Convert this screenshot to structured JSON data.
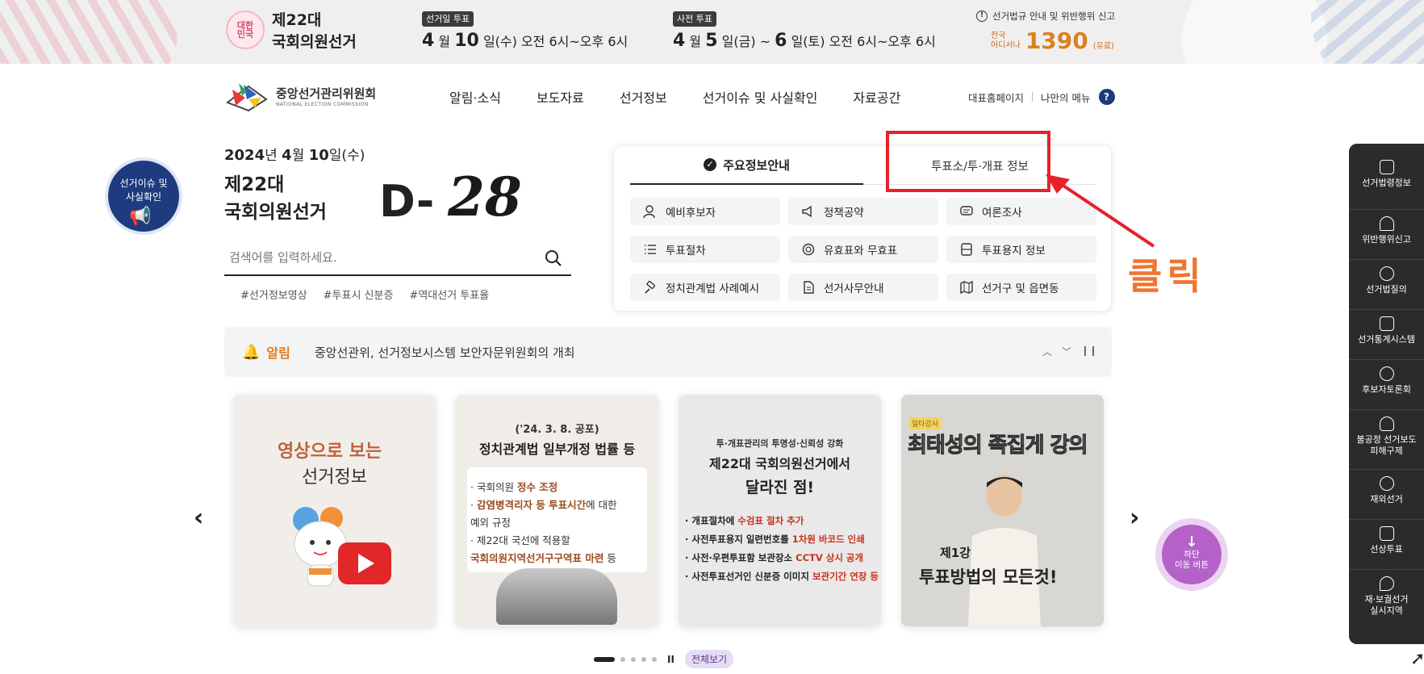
{
  "banner": {
    "logo_text": "대한\n민국",
    "election_title_line1": "제22대",
    "election_title_line2": "국회의원선거",
    "election_day_tag": "선거일 투표",
    "election_day_month": "4",
    "election_day_month_unit": "월",
    "election_day_day": "10",
    "election_day_rest": "일(수) 오전 6시~오후 6시",
    "early_vote_tag": "사전 투표",
    "early_month": "4",
    "early_month_unit": "월",
    "early_day1": "5",
    "early_mid": "일(금) ~",
    "early_day2": "6",
    "early_rest": "일(토) 오전 6시~오후 6시",
    "report_text": "선거법규 안내 및 위반행위 신고",
    "hotline_small1": "전국",
    "hotline_small2": "어디서나",
    "hotline_number": "1390",
    "hotline_fee": "(유료)"
  },
  "header": {
    "org_name": "중앙선거관리위원회",
    "org_sub": "NATIONAL ELECTION COMMISSION",
    "nav": [
      "알림·소식",
      "보도자료",
      "선거정보",
      "선거이슈 및 사실확인",
      "자료공간"
    ],
    "util_home": "대표홈페이지",
    "util_menu": "나만의 메뉴",
    "help": "?"
  },
  "issue_badge": "선거이슈 및\n사실확인",
  "dday": {
    "date_year": "2024",
    "date_year_unit": "년",
    "date_month": "4",
    "date_month_unit": "월",
    "date_day": "10",
    "date_day_rest": "일(수)",
    "title_line1": "제22대",
    "title_line2": "국회의원선거",
    "label": "D-",
    "number": "28"
  },
  "search": {
    "placeholder": "검색어를 입력하세요.",
    "hashtags": [
      "#선거정보영상",
      "#투표시 신분증",
      "#역대선거 투표율"
    ]
  },
  "info_panel": {
    "tab_active": "주요정보안내",
    "tab_inactive": "투표소/투·개표 정보",
    "items": [
      "예비후보자",
      "정책공약",
      "여론조사",
      "투표절차",
      "유효표와 무효표",
      "투표용지 정보",
      "정치관계법 사례예시",
      "선거사무안내",
      "선거구 및 읍면동"
    ]
  },
  "annotation": {
    "click_text": "클릭",
    "color": "#e8202a"
  },
  "notice": {
    "label": "알림",
    "text": "중앙선관위, 선거정보시스템 보안자문위원회의 개최"
  },
  "cards": {
    "c1_title1": "영상으로 보는",
    "c1_title2": "선거정보",
    "c2_head1": "('24. 3. 8. 공포)",
    "c2_head2": "정치관계법 일부개정 법률 등",
    "c2_l1a": "· 국회의원 ",
    "c2_l1b": "정수 조정",
    "c2_l2a": "· ",
    "c2_l2b": "감염병격리자 등 투표시간",
    "c2_l2c": "에 대한",
    "c2_l3": "  예외 규정",
    "c2_l4": "· 제22대 국선에 적용할",
    "c2_l5": "  국회의원지역선거구구역표 마련",
    "c2_l5b": " 등",
    "c3_head1": "투·개표관리의 투명성·신뢰성 강화",
    "c3_head2": "제22대 국회의원선거에서",
    "c3_head3": "달라진 점!",
    "c3_l1a": "· 개표절차에 ",
    "c3_l1b": "수검표 절차 추가",
    "c3_l2a": "· 사전투표용지 일련번호를 ",
    "c3_l2b": "1차원 바코드 인쇄",
    "c3_l3a": "· 사전·우편투표함 보관장소 ",
    "c3_l3b": "CCTV 상시 공개",
    "c3_l4a": "· 사전투표선거인 신분증 이미지 ",
    "c3_l4b": "보관기간 연장 등",
    "c4_tag": "일타강사",
    "c4_title": "최태성의 족집게 강의",
    "c4_lesson": "제1강",
    "c4_sub": "투표방법의 모든것!"
  },
  "down_button": {
    "arrow": "↓",
    "line1": "하단",
    "line2": "이동 버튼"
  },
  "pager": {
    "pause": "II",
    "view_all": "전체보기"
  },
  "quick_menu": [
    "선거법령정보",
    "위반행위신고",
    "선거법질의",
    "선거통계시스템",
    "후보자토론회",
    "불공정 선거보도\n피해구제",
    "재외선거",
    "선상투표",
    "재·보궐선거\n실시지역"
  ],
  "colors": {
    "brand_navy": "#1d3b7e",
    "orange": "#e87a1c",
    "purple": "#b462c8"
  }
}
